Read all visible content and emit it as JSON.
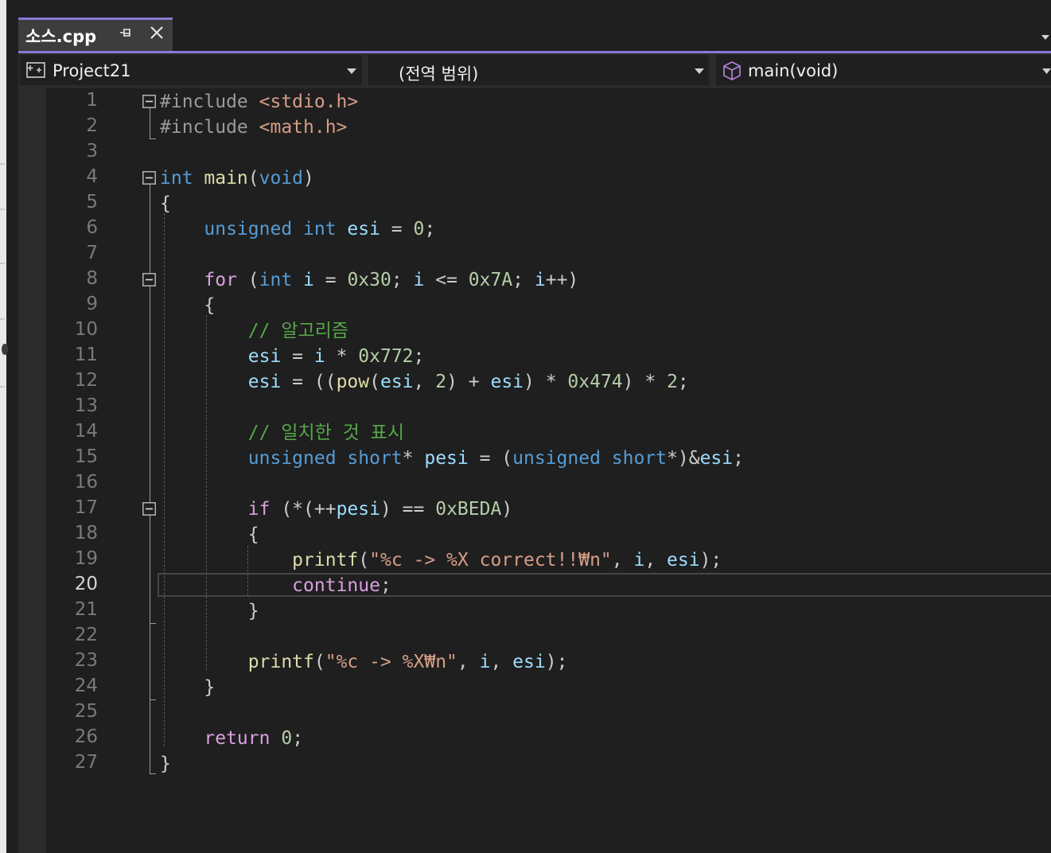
{
  "tab": {
    "title": "소스.cpp"
  },
  "navbar": {
    "project": "Project21",
    "scope": "(전역 범위)",
    "member": "main(void)"
  },
  "editor": {
    "active_line": 20,
    "line_numbers": [
      "1",
      "2",
      "3",
      "4",
      "5",
      "6",
      "7",
      "8",
      "9",
      "10",
      "11",
      "12",
      "13",
      "14",
      "15",
      "16",
      "17",
      "18",
      "19",
      "20",
      "21",
      "22",
      "23",
      "24",
      "25",
      "26",
      "27"
    ],
    "lines": [
      [
        [
          "#include ",
          "pre"
        ],
        [
          "<stdio.h>",
          "str"
        ]
      ],
      [
        [
          "#include ",
          "pre"
        ],
        [
          "<math.h>",
          "str"
        ]
      ],
      [],
      [
        [
          "int ",
          "kw"
        ],
        [
          "main",
          "fn"
        ],
        [
          "(",
          "p"
        ],
        [
          "void",
          "kw"
        ],
        [
          ")",
          "p"
        ]
      ],
      [
        [
          "{",
          "p"
        ]
      ],
      [
        [
          "    "
        ],
        [
          "unsigned ",
          "kw"
        ],
        [
          "int ",
          "kw"
        ],
        [
          "esi",
          "var"
        ],
        [
          " = ",
          "p"
        ],
        [
          "0",
          "num"
        ],
        [
          ";",
          "p"
        ]
      ],
      [],
      [
        [
          "    "
        ],
        [
          "for ",
          "ctl"
        ],
        [
          "(",
          "p"
        ],
        [
          "int ",
          "kw"
        ],
        [
          "i",
          "var"
        ],
        [
          " = ",
          "p"
        ],
        [
          "0x30",
          "num"
        ],
        [
          "; ",
          "p"
        ],
        [
          "i",
          "var"
        ],
        [
          " <= ",
          "p"
        ],
        [
          "0x7A",
          "num"
        ],
        [
          "; ",
          "p"
        ],
        [
          "i",
          "var"
        ],
        [
          "++)",
          "p"
        ]
      ],
      [
        [
          "    "
        ],
        [
          "{",
          "p"
        ]
      ],
      [
        [
          "        "
        ],
        [
          "// 알고리즘",
          "cmt"
        ]
      ],
      [
        [
          "        "
        ],
        [
          "esi",
          "var"
        ],
        [
          " = ",
          "p"
        ],
        [
          "i",
          "var"
        ],
        [
          " * ",
          "p"
        ],
        [
          "0x772",
          "num"
        ],
        [
          ";",
          "p"
        ]
      ],
      [
        [
          "        "
        ],
        [
          "esi",
          "var"
        ],
        [
          " = ((",
          "p"
        ],
        [
          "pow",
          "fn"
        ],
        [
          "(",
          "p"
        ],
        [
          "esi",
          "var"
        ],
        [
          ", ",
          "p"
        ],
        [
          "2",
          "num"
        ],
        [
          ") + ",
          "p"
        ],
        [
          "esi",
          "var"
        ],
        [
          ") * ",
          "p"
        ],
        [
          "0x474",
          "num"
        ],
        [
          ") * ",
          "p"
        ],
        [
          "2",
          "num"
        ],
        [
          ";",
          "p"
        ]
      ],
      [],
      [
        [
          "        "
        ],
        [
          "// 일치한 것 표시",
          "cmt"
        ]
      ],
      [
        [
          "        "
        ],
        [
          "unsigned ",
          "kw"
        ],
        [
          "short",
          "kw"
        ],
        [
          "* ",
          "p"
        ],
        [
          "pesi",
          "var"
        ],
        [
          " = (",
          "p"
        ],
        [
          "unsigned ",
          "kw"
        ],
        [
          "short",
          "kw"
        ],
        [
          "*)&",
          "p"
        ],
        [
          "esi",
          "var"
        ],
        [
          ";",
          "p"
        ]
      ],
      [],
      [
        [
          "        "
        ],
        [
          "if ",
          "ctl"
        ],
        [
          "(*(++",
          "p"
        ],
        [
          "pesi",
          "var"
        ],
        [
          ") == ",
          "p"
        ],
        [
          "0xBEDA",
          "num"
        ],
        [
          ")",
          "p"
        ]
      ],
      [
        [
          "        "
        ],
        [
          "{",
          "p"
        ]
      ],
      [
        [
          "            "
        ],
        [
          "printf",
          "fn"
        ],
        [
          "(",
          "p"
        ],
        [
          "\"%c -> %X correct!!₩n\"",
          "str"
        ],
        [
          ", ",
          "p"
        ],
        [
          "i",
          "var"
        ],
        [
          ", ",
          "p"
        ],
        [
          "esi",
          "var"
        ],
        [
          ");",
          "p"
        ]
      ],
      [
        [
          "            "
        ],
        [
          "continue",
          "ctl"
        ],
        [
          ";",
          "p"
        ]
      ],
      [
        [
          "        "
        ],
        [
          "}",
          "p"
        ]
      ],
      [],
      [
        [
          "        "
        ],
        [
          "printf",
          "fn"
        ],
        [
          "(",
          "p"
        ],
        [
          "\"%c -> %X₩n\"",
          "str"
        ],
        [
          ", ",
          "p"
        ],
        [
          "i",
          "var"
        ],
        [
          ", ",
          "p"
        ],
        [
          "esi",
          "var"
        ],
        [
          ");",
          "p"
        ]
      ],
      [
        [
          "    "
        ],
        [
          "}",
          "p"
        ]
      ],
      [],
      [
        [
          "    "
        ],
        [
          "return ",
          "ctl"
        ],
        [
          "0",
          "num"
        ],
        [
          ";",
          "p"
        ]
      ],
      [
        [
          "}",
          "p"
        ]
      ]
    ]
  },
  "colors": {
    "pre": "#9b9b9b",
    "str": "#d69d85",
    "kw": "#569cd6",
    "ctl": "#d8a0df",
    "fn": "#dcdcaa",
    "var": "#9cdcfe",
    "num": "#b5cea8",
    "cmt": "#57a64a",
    "p": "#cccccc",
    "accent": "#8b77d6"
  },
  "icons": {
    "pin": "pin-icon",
    "close": "close-icon",
    "project": "project-icon",
    "member": "cube-icon"
  }
}
